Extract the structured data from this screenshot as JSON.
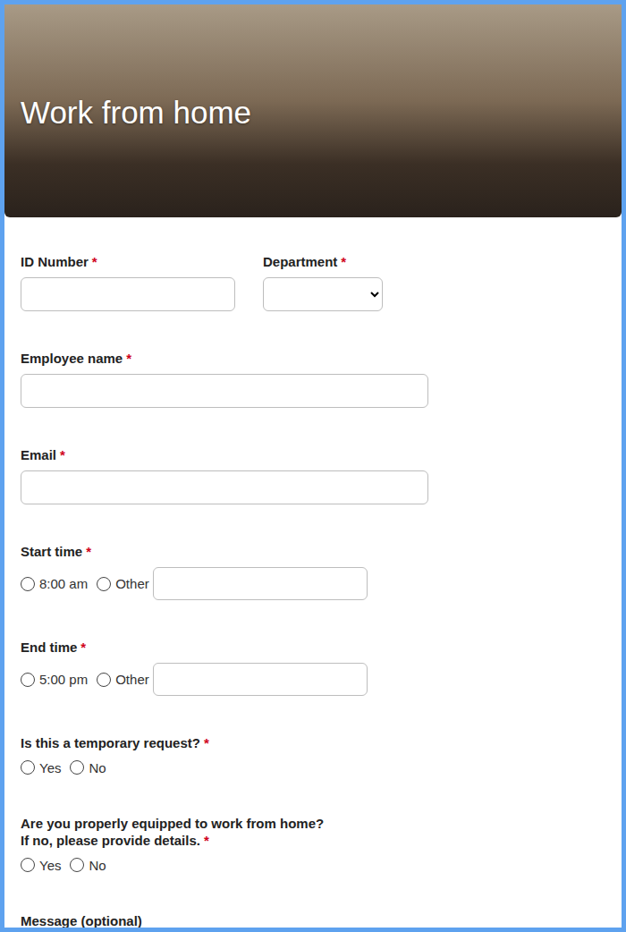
{
  "header": {
    "title": "Work from home"
  },
  "form": {
    "required_mark": "*",
    "rows": [
      [
        {
          "label": "ID Number",
          "required": true,
          "kind": "text",
          "value": ""
        },
        {
          "label": "Department",
          "required": true,
          "kind": "select",
          "value": ""
        }
      ],
      [
        {
          "label": "Employee name",
          "required": true,
          "kind": "text",
          "value": ""
        }
      ],
      [
        {
          "label": "Email",
          "required": true,
          "kind": "text",
          "value": ""
        }
      ],
      [
        {
          "label": "Start time",
          "required": true,
          "kind": "radio",
          "options": [
            {
              "label": "8:00 am",
              "selected": false,
              "kind": "plain"
            },
            {
              "label": "Other",
              "selected": false,
              "kind": "other"
            }
          ]
        }
      ],
      [
        {
          "label": "End time",
          "required": true,
          "kind": "radio",
          "options": [
            {
              "label": "5:00 pm",
              "selected": false,
              "kind": "plain"
            },
            {
              "label": "Other",
              "selected": false,
              "kind": "other"
            }
          ]
        }
      ],
      [
        {
          "label": "Is this a temporary request?",
          "required": true,
          "kind": "radio",
          "options": [
            {
              "label": "Yes",
              "selected": false,
              "kind": "plain"
            },
            {
              "label": "No",
              "selected": false,
              "kind": "plain"
            }
          ]
        }
      ],
      [
        {
          "label": "Are you properly equipped to work from home?",
          "hint": "If no, please provide details.",
          "required": true,
          "kind": "radio",
          "options": [
            {
              "label": "Yes",
              "selected": false,
              "kind": "plain"
            },
            {
              "label": "No",
              "selected": false,
              "kind": "plain"
            }
          ]
        }
      ],
      [
        {
          "label": "Message (optional)",
          "required": false,
          "kind": "textarea",
          "value": ""
        }
      ]
    ]
  }
}
